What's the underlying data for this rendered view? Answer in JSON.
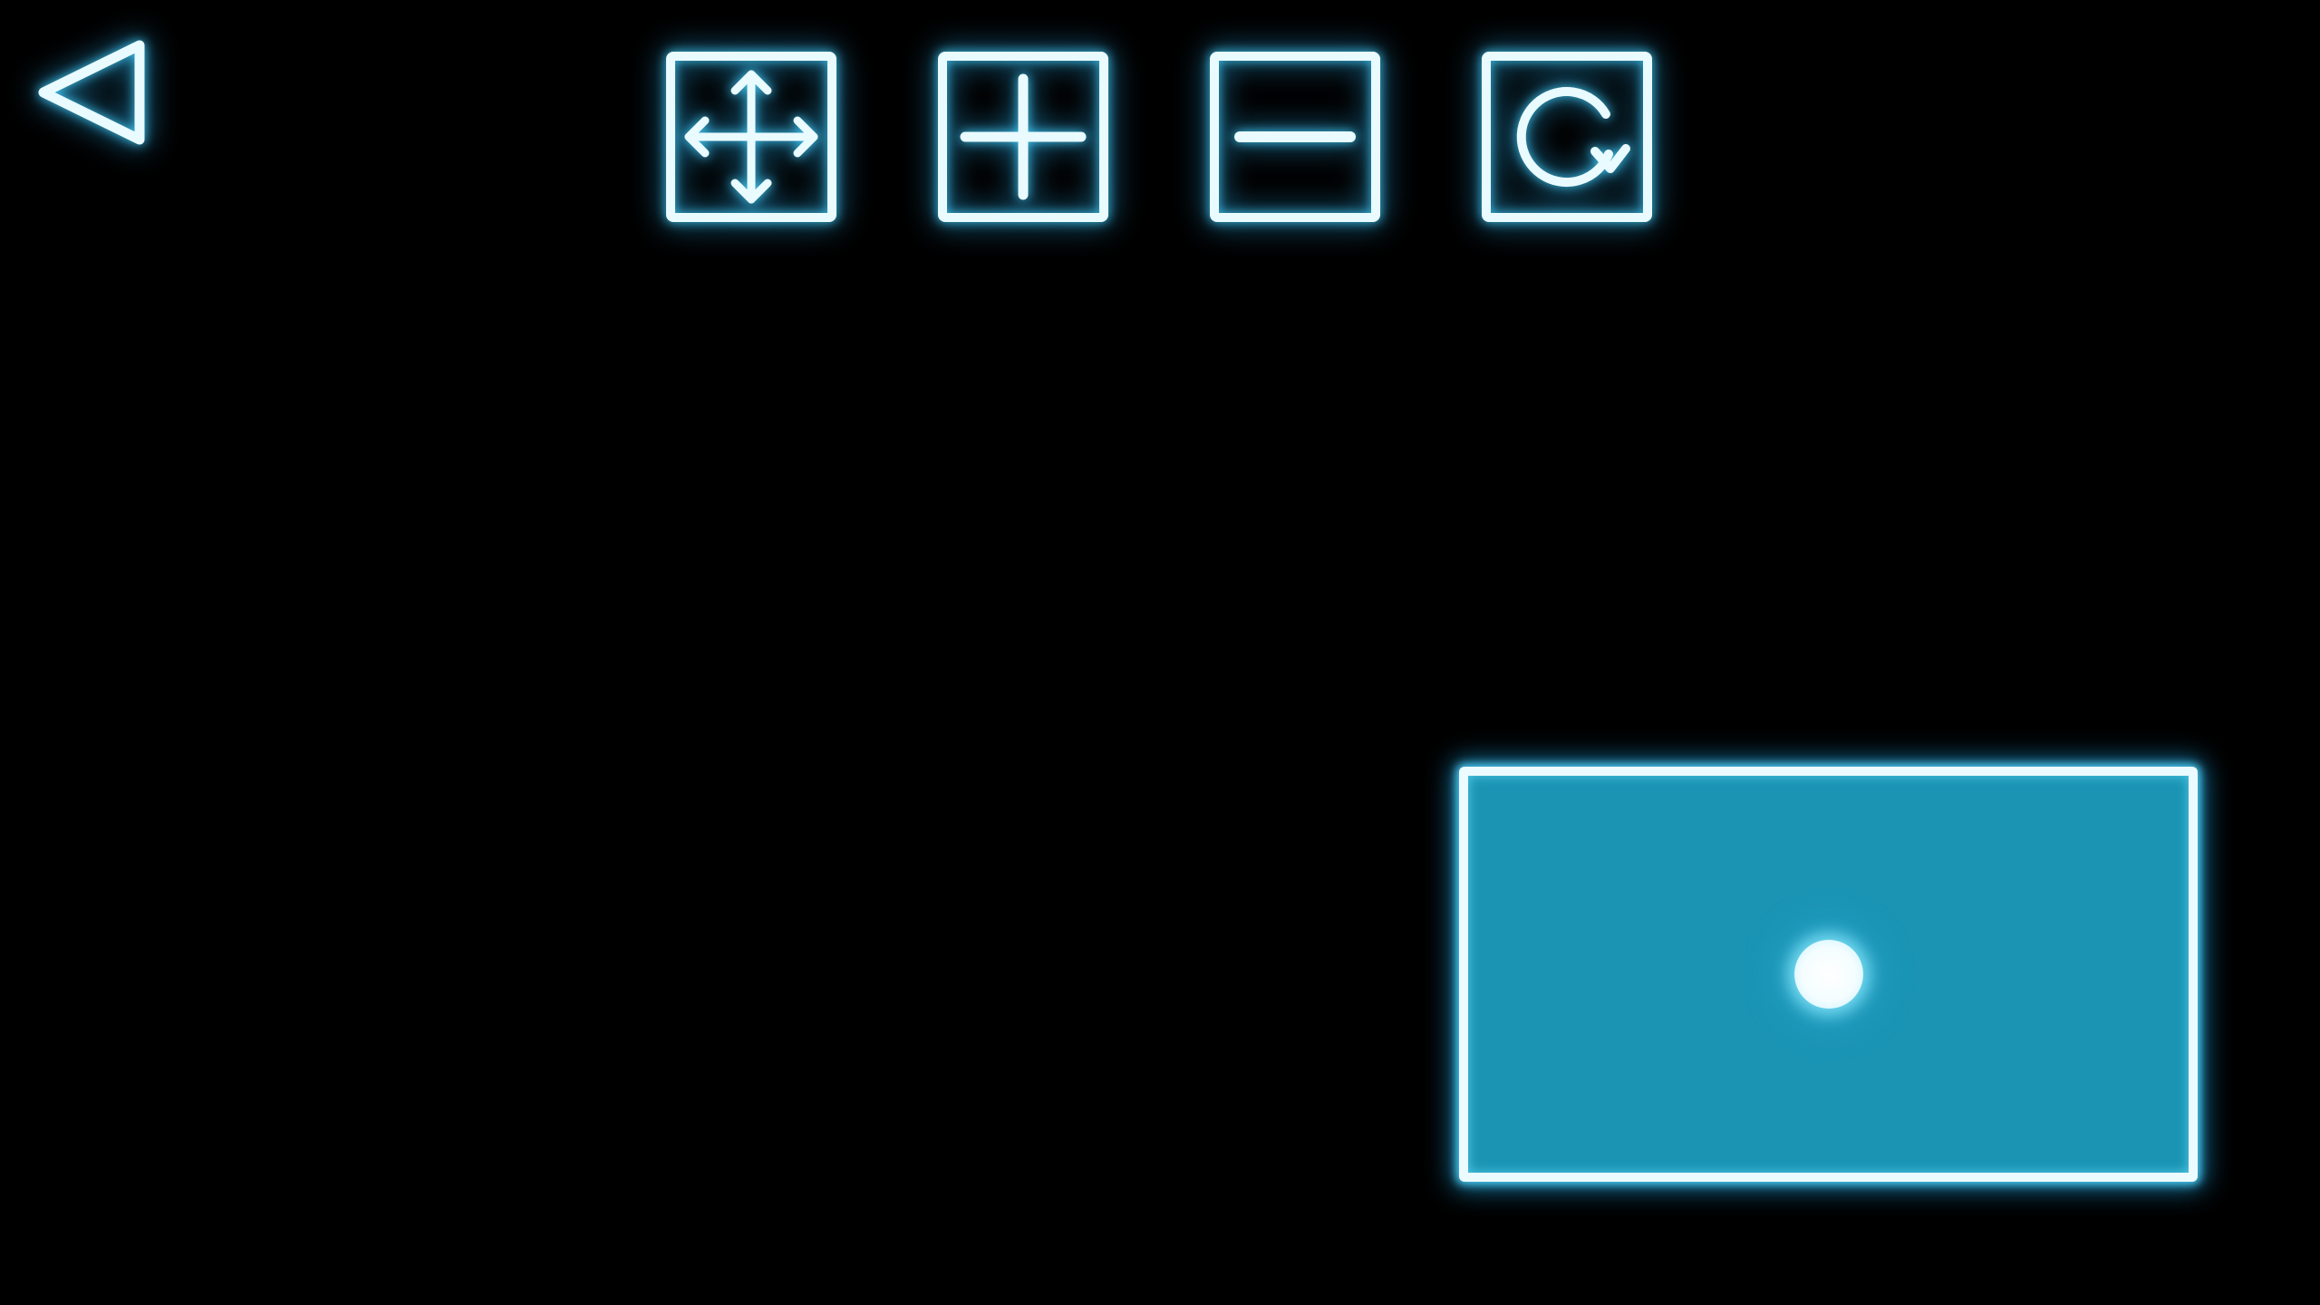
{
  "screen": {
    "background_color": "#000000"
  },
  "theme": {
    "neon_stroke": "#e9fbff",
    "neon_glow": "#36c8f5",
    "block_fill": "#1b94b4",
    "dot_fill": "#ffffff"
  },
  "navigation": {
    "back_icon": "triangle-left-icon"
  },
  "toolbar": {
    "buttons": [
      {
        "id": "move",
        "icon": "move-arrows-icon"
      },
      {
        "id": "add",
        "icon": "plus-icon"
      },
      {
        "id": "remove",
        "icon": "minus-icon"
      },
      {
        "id": "rotate",
        "icon": "rotate-icon"
      }
    ]
  },
  "play_area": {
    "block": {
      "shape": "rectangle",
      "icon": "center-dot-icon"
    }
  }
}
